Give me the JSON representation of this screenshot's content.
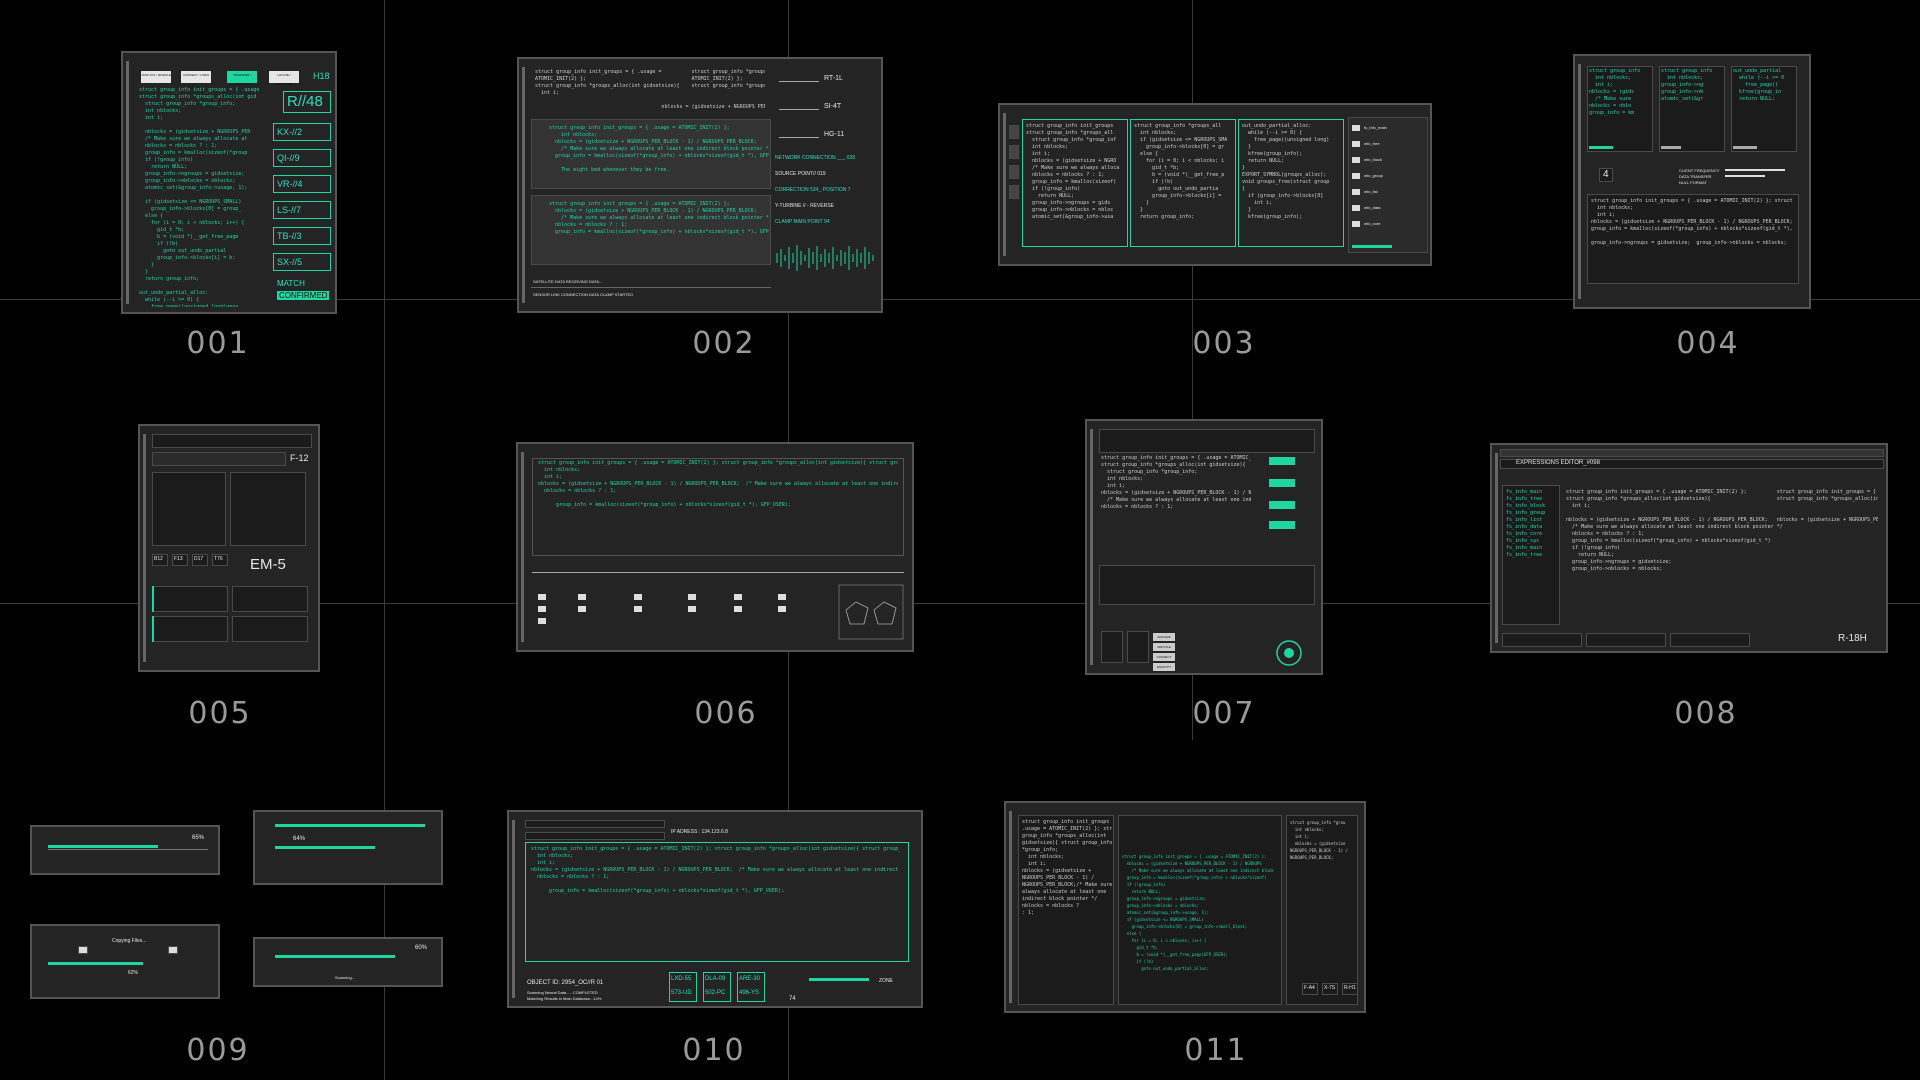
{
  "labels": [
    "001",
    "002",
    "003",
    "004",
    "005",
    "006",
    "007",
    "008",
    "009",
    "010",
    "011"
  ],
  "p001": {
    "tabs": [
      "TASK FOL / MODULE",
      "CONNECT / LINKS",
      "TRANSFER / COMPLETE",
      "LOCATE / ENTRANCE"
    ],
    "id_top": "H18",
    "big_id": "R//48",
    "codes": [
      "KX-//2",
      "QI-//9",
      "VR-//4",
      "LS-//7",
      "TB-//3",
      "SX-//5"
    ],
    "match": "MATCH",
    "confirmed": "CONFIRMED"
  },
  "p002": {
    "ids": [
      "RT-1L",
      "SI-4T",
      "HG-11"
    ],
    "status": [
      "NETWORK CONNECTION ___ 028",
      "SOURCE POINT// 019",
      "CORRECTION 534_ POSITION 7",
      "Y-TURBINE // - REVERSE",
      "CLAMP MAIN POINT 94"
    ],
    "footer1": "SATELLITE DATA RECEIVING DATA...",
    "footer2": "SENSOR LINK CONNECTION DATA CLAMP STARTED"
  },
  "p003": {
    "files": [
      "fs_info_main",
      "info_tree",
      "info_block",
      "info_group",
      "info_list",
      "info_data",
      "info_core",
      "info_sys"
    ]
  },
  "p004": {
    "num": "4",
    "rows": [
      "CLIENT FREQUENCY",
      "DATA TRANSFER",
      "NULL FORMAT"
    ]
  },
  "p005": {
    "top_id": "F-12",
    "big_id": "EM-5",
    "codes": [
      "B12",
      "F13",
      "D17",
      "T76"
    ]
  },
  "p007": {
    "buttons": [
      "ARCHIVE",
      "ADD FILE",
      "CONNECT",
      "ENCRYPT"
    ]
  },
  "p008": {
    "title": "EXPRESSIONS EDITOR_#098",
    "code_id": "R-18H"
  },
  "p009": {
    "pct": [
      "65%",
      "64%",
      "62%",
      "60%"
    ],
    "copy_title": "Copying Files...",
    "note": "Scanning..."
  },
  "p010": {
    "address": "IP ADRESS : 134.123.6.8",
    "object": "OBJECT ID: 2954_OC//R 01",
    "line2": "Scanning Neural Data.....  COMPLETED",
    "line3": "Matching Results in Main Database...14%",
    "codes": [
      "LXD-55",
      "573-UD",
      "DLA-09",
      "502-PC",
      "ARE-30",
      "496-YS"
    ],
    "zone": "ZONE",
    "code_small": "74"
  },
  "p011": {
    "codes": [
      "F-A4",
      "X-7S",
      "R-H1"
    ]
  }
}
